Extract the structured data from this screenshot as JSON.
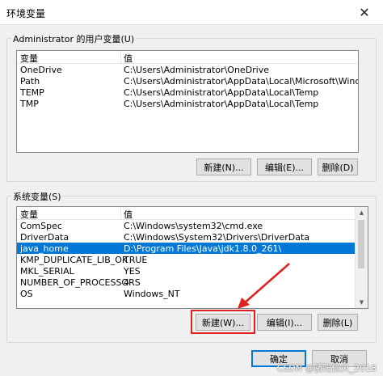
{
  "window": {
    "title": "环境变量",
    "close_glyph": "✕"
  },
  "user_vars": {
    "group_label": "Administrator 的用户变量(U)",
    "columns": [
      "变量",
      "值"
    ],
    "rows": [
      {
        "name": "OneDrive",
        "value": "C:\\Users\\Administrator\\OneDrive"
      },
      {
        "name": "Path",
        "value": "C:\\Users\\Administrator\\AppData\\Local\\Microsoft\\WindowsApps;"
      },
      {
        "name": "TEMP",
        "value": "C:\\Users\\Administrator\\AppData\\Local\\Temp"
      },
      {
        "name": "TMP",
        "value": "C:\\Users\\Administrator\\AppData\\Local\\Temp"
      }
    ],
    "buttons": {
      "new": "新建(N)...",
      "edit": "编辑(E)...",
      "delete": "删除(D)"
    }
  },
  "system_vars": {
    "group_label": "系统变量(S)",
    "columns": [
      "变量",
      "值"
    ],
    "rows": [
      {
        "name": "ComSpec",
        "value": "C:\\Windows\\system32\\cmd.exe"
      },
      {
        "name": "DriverData",
        "value": "C:\\Windows\\System32\\Drivers\\DriverData"
      },
      {
        "name": "java_home",
        "value": "D:\\Program Files\\Java\\jdk1.8.0_261\\",
        "selected": true
      },
      {
        "name": "KMP_DUPLICATE_LIB_OK",
        "value": "TRUE"
      },
      {
        "name": "MKL_SERIAL",
        "value": "YES"
      },
      {
        "name": "NUMBER_OF_PROCESSORS",
        "value": "4"
      },
      {
        "name": "OS",
        "value": "Windows_NT"
      }
    ],
    "buttons": {
      "new": "新建(W)...",
      "edit": "编辑(I)...",
      "delete": "删除(L)"
    }
  },
  "footer": {
    "ok": "确定",
    "cancel": "取消"
  },
  "annotation": {
    "highlight_color": "#e02020",
    "selection_color": "#0078d7"
  },
  "watermark": "CSDN @骄阳似火_2018"
}
